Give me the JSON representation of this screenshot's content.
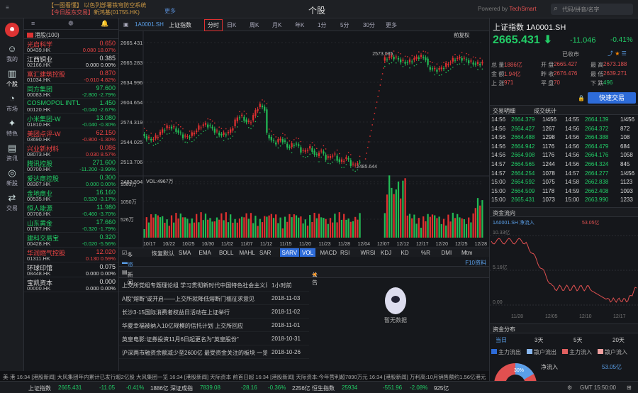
{
  "window": {
    "title": "个股",
    "top_left": "≡",
    "news_line1": "【一图看懂】 以色列部署铁穹防空系统",
    "news_line2_prefix": "【今日股东交易】",
    "news_line2": "新鸿基(01755.HK)",
    "more": "更多",
    "powered": "Powered by",
    "brand": "TechSmart",
    "search_placeholder": "代码/拼音/名字"
  },
  "nav": [
    {
      "label": "我的",
      "icon": "☺"
    },
    {
      "label": "个股",
      "icon": "▥"
    },
    {
      "label": "市场",
      "icon": "◔"
    },
    {
      "label": "特色",
      "icon": "✦"
    },
    {
      "label": "资讯",
      "icon": "▤"
    },
    {
      "label": "新股",
      "icon": "◎"
    },
    {
      "label": "交易",
      "icon": "⇄"
    }
  ],
  "watchlist": {
    "tabs": [
      "≡",
      "❁",
      "🔔"
    ],
    "group": "港股(100)",
    "rows": [
      {
        "name": "光启科学",
        "code": "00439.HK",
        "price": "0.650",
        "change": "0.080",
        "pct": "18.07%",
        "dir": "up"
      },
      {
        "name": "江西铜业",
        "code": "02166.HK",
        "price": "0.385",
        "change": "0.000",
        "pct": "0.00%",
        "dir": "wh"
      },
      {
        "name": "富汇建筑控股",
        "code": "01034.HK",
        "price": "0.870",
        "change": "-0.010",
        "pct": "4.82%",
        "dir": "up"
      },
      {
        "name": "同方集团",
        "code": "00083.HK",
        "price": "97.600",
        "change": "-2.800",
        "pct": "-2.79%",
        "dir": "dn"
      },
      {
        "name": "COSMOPOL INT'L",
        "code": "00120.HK",
        "price": "1.450",
        "change": "-0.040",
        "pct": "-2.67%",
        "dir": "dn"
      },
      {
        "name": "小米集团-W",
        "code": "01810.HK",
        "price": "13.080",
        "change": "-0.040",
        "pct": "-0.30%",
        "dir": "dn"
      },
      {
        "name": "美团点评-W",
        "code": "03690.HK",
        "price": "62.150",
        "change": "-0.800",
        "pct": "-1.30%",
        "dir": "up"
      },
      {
        "name": "兴业新材料",
        "code": "08073.HK",
        "price": "0.086",
        "change": "0.030",
        "pct": "8.57%",
        "dir": "up"
      },
      {
        "name": "腾讯控股",
        "code": "00700.HK",
        "price": "271.600",
        "change": "-11.200",
        "pct": "-3.99%",
        "dir": "dn"
      },
      {
        "name": "爱达商控股",
        "code": "08307.HK",
        "price": "0.300",
        "change": "0.000",
        "pct": "0.00%",
        "dir": "dn"
      },
      {
        "name": "金地商业",
        "code": "00535.HK",
        "price": "16.160",
        "change": "0.520",
        "pct": "-3.17%",
        "dir": "dn"
      },
      {
        "name": "恒人能源",
        "code": "00708.HK",
        "price": "11.980",
        "change": "-0.460",
        "pct": "-3.70%",
        "dir": "dn"
      },
      {
        "name": "山东黄金",
        "code": "01787.HK",
        "price": "17.660",
        "change": "-0.320",
        "pct": "-1.79%",
        "dir": "dn"
      },
      {
        "name": "建科交易宝",
        "code": "00428.HK",
        "price": "0.320",
        "change": "-0.020",
        "pct": "-5.56%",
        "dir": "dn"
      },
      {
        "name": "华润燃气控股",
        "code": "01311.HK",
        "price": "12.020",
        "change": "0.130",
        "pct": "0.59%",
        "dir": "up"
      },
      {
        "name": "环球印馆",
        "code": "08448.HK",
        "price": "0.075",
        "change": "0.000",
        "pct": "0.00%",
        "dir": "wh"
      },
      {
        "name": "宝凯资本",
        "code": "00000.HK",
        "price": "0.000",
        "change": "0.000",
        "pct": "0.00%",
        "dir": "wh"
      }
    ]
  },
  "toolbar": {
    "code": "1A0001.SH",
    "name": "上证指数",
    "tabs": [
      "分时",
      "日K",
      "周K",
      "月K",
      "年K",
      "1分",
      "5分",
      "30分",
      "更多"
    ],
    "selected": "分时"
  },
  "chart_data": {
    "type": "line",
    "y_ticks": [
      "2665.431",
      "2665.283",
      "2634.996",
      "2604.654",
      "2574.319",
      "2544.025",
      "2513.706",
      "2483.394"
    ],
    "x_ticks": [
      "10/17",
      "10/22",
      "10/25",
      "10/30",
      "11/02",
      "11/07",
      "11/12",
      "11/15",
      "11/20",
      "11/23",
      "11/28",
      "12/04",
      "12/07",
      "12/12",
      "12/17",
      "12/20",
      "12/25",
      "12/28"
    ],
    "labels": {
      "peak": "2573.085",
      "low": "2485.644",
      "vol_label": "VOL:4967万",
      "vol_ticks": [
        "1583万",
        "1050万",
        "526万"
      ],
      "corner": "前复权"
    }
  },
  "indicators": {
    "master": "多指标",
    "default": "恢复默认",
    "items": [
      "SMA",
      "EMA",
      "BOLL",
      "MAHL",
      "SAR",
      "SARV",
      "VOL",
      "MACD",
      "RSI",
      "WRSI",
      "KDJ",
      "KD",
      "%R",
      "DMI",
      "Mtm"
    ],
    "selected": "SARV"
  },
  "news": {
    "tab": "资讯",
    "f10": "F10资料",
    "sub": [
      "新闻",
      "公告"
    ],
    "items": [
      {
        "title": "上交所党组专题理论组 学习贯彻新时代中国特色社会主义思想",
        "date": "1小时前"
      },
      {
        "title": "A股\"熔断\"或开启——上交所就降低熔断门槛征求意见",
        "date": "2018-11-03"
      },
      {
        "title": "长沙3·15国际消费者权益日活动在上证举行",
        "date": "2018-11-02"
      },
      {
        "title": "华夏幸福被纳入10亿规模的信托计划 上交所回应",
        "date": "2018-11-01"
      },
      {
        "title": "英皇电影:证券投资11月6日起更名为\"英皇股份\"",
        "date": "2018-10-31"
      },
      {
        "title": "沪深两市融资余额减少至2600亿 最受资金关注的板块 一览",
        "date": "2018-10-26"
      }
    ],
    "empty": "暂无数据"
  },
  "quote": {
    "name": "上证指数",
    "code": "1A0001.SH",
    "price": "2665.431",
    "change": "-11.046",
    "pct": "-0.41%",
    "market": "已收市",
    "fields": [
      [
        "总 量",
        "1886亿",
        "开 盘",
        "2665.427",
        "最 高",
        "2673.188"
      ],
      [
        "金 额",
        "1.94亿",
        "昨 收",
        "2676.476",
        "最 低",
        "2639.271"
      ],
      [
        "上 涨",
        "971",
        "平 盘",
        "70",
        "下 跌",
        "496"
      ]
    ],
    "buy": "快速交易",
    "tabs": [
      "交易明细",
      "成交统计"
    ],
    "ticks": [
      [
        "14:56",
        "2664.379",
        "1/456",
        "14:55",
        "2664.139",
        "1/456"
      ],
      [
        "14:56",
        "2664.427",
        "1267",
        "14:56",
        "2664.372",
        "872"
      ],
      [
        "14:56",
        "2664.488",
        "1298",
        "14:56",
        "2664.388",
        "108"
      ],
      [
        "14:56",
        "2664.942",
        "1176",
        "14:56",
        "2664.479",
        "684"
      ],
      [
        "14:56",
        "2664.908",
        "1176",
        "14:56",
        "2664.176",
        "1058"
      ],
      [
        "14:57",
        "2664.565",
        "1244",
        "14:56",
        "2664.324",
        "845"
      ],
      [
        "14:57",
        "2664.254",
        "1078",
        "14:57",
        "2664.277",
        "1/456"
      ],
      [
        "15:00",
        "2664.592",
        "1075",
        "14:58",
        "2662.838",
        "1123"
      ],
      [
        "15:00",
        "2664.509",
        "1178",
        "14:59",
        "2662.408",
        "1093"
      ],
      [
        "15:00",
        "2665.431",
        "1073",
        "15:00",
        "2663.990",
        "1233"
      ]
    ],
    "flow_title": "资金流向",
    "flow_label": "1A0001.SH 净流入",
    "flow_value": "53.05亿",
    "flow_y": [
      "10.33亿",
      "5.16亿",
      "0.00"
    ],
    "flow_x": [
      "11/28",
      "12/05",
      "12/10",
      "12/17"
    ],
    "dist_title": "资金分布",
    "dist_tabs": [
      "当日",
      "3天",
      "5天",
      "20天"
    ],
    "dist_legend": [
      "主力流出",
      "散户流出",
      "主力流入",
      "散户流入"
    ],
    "dist_center": "净流入",
    "dist_val": "53.05亿",
    "pie_pct": "30%"
  },
  "status": {
    "ticker": "美·港 16:34 [港股新闻] 大风集团年内累计已发行超2亿股 大风集团一览 16:34 [港股新闻] 天际资本 前首日超 16:34 [港股新闻] 天际资本:今年营利超7890万元 16:34 [港股新闻] 万利高:10月销售额约1.56亿港元",
    "items": [
      {
        "l": "上证指数",
        "v": "2665.431",
        "c": "-11.05",
        "p": "-0.41%",
        "a": "1886亿"
      },
      {
        "l": "深证成指",
        "v": "7839.08",
        "c": "-28.16",
        "p": "-0.36%",
        "a": "2256亿"
      },
      {
        "l": "恒生指数",
        "v": "25934",
        "c": "-551.96",
        "p": "-2.08%",
        "a": "925亿"
      }
    ],
    "gmt": "GMT 15:50:00"
  }
}
